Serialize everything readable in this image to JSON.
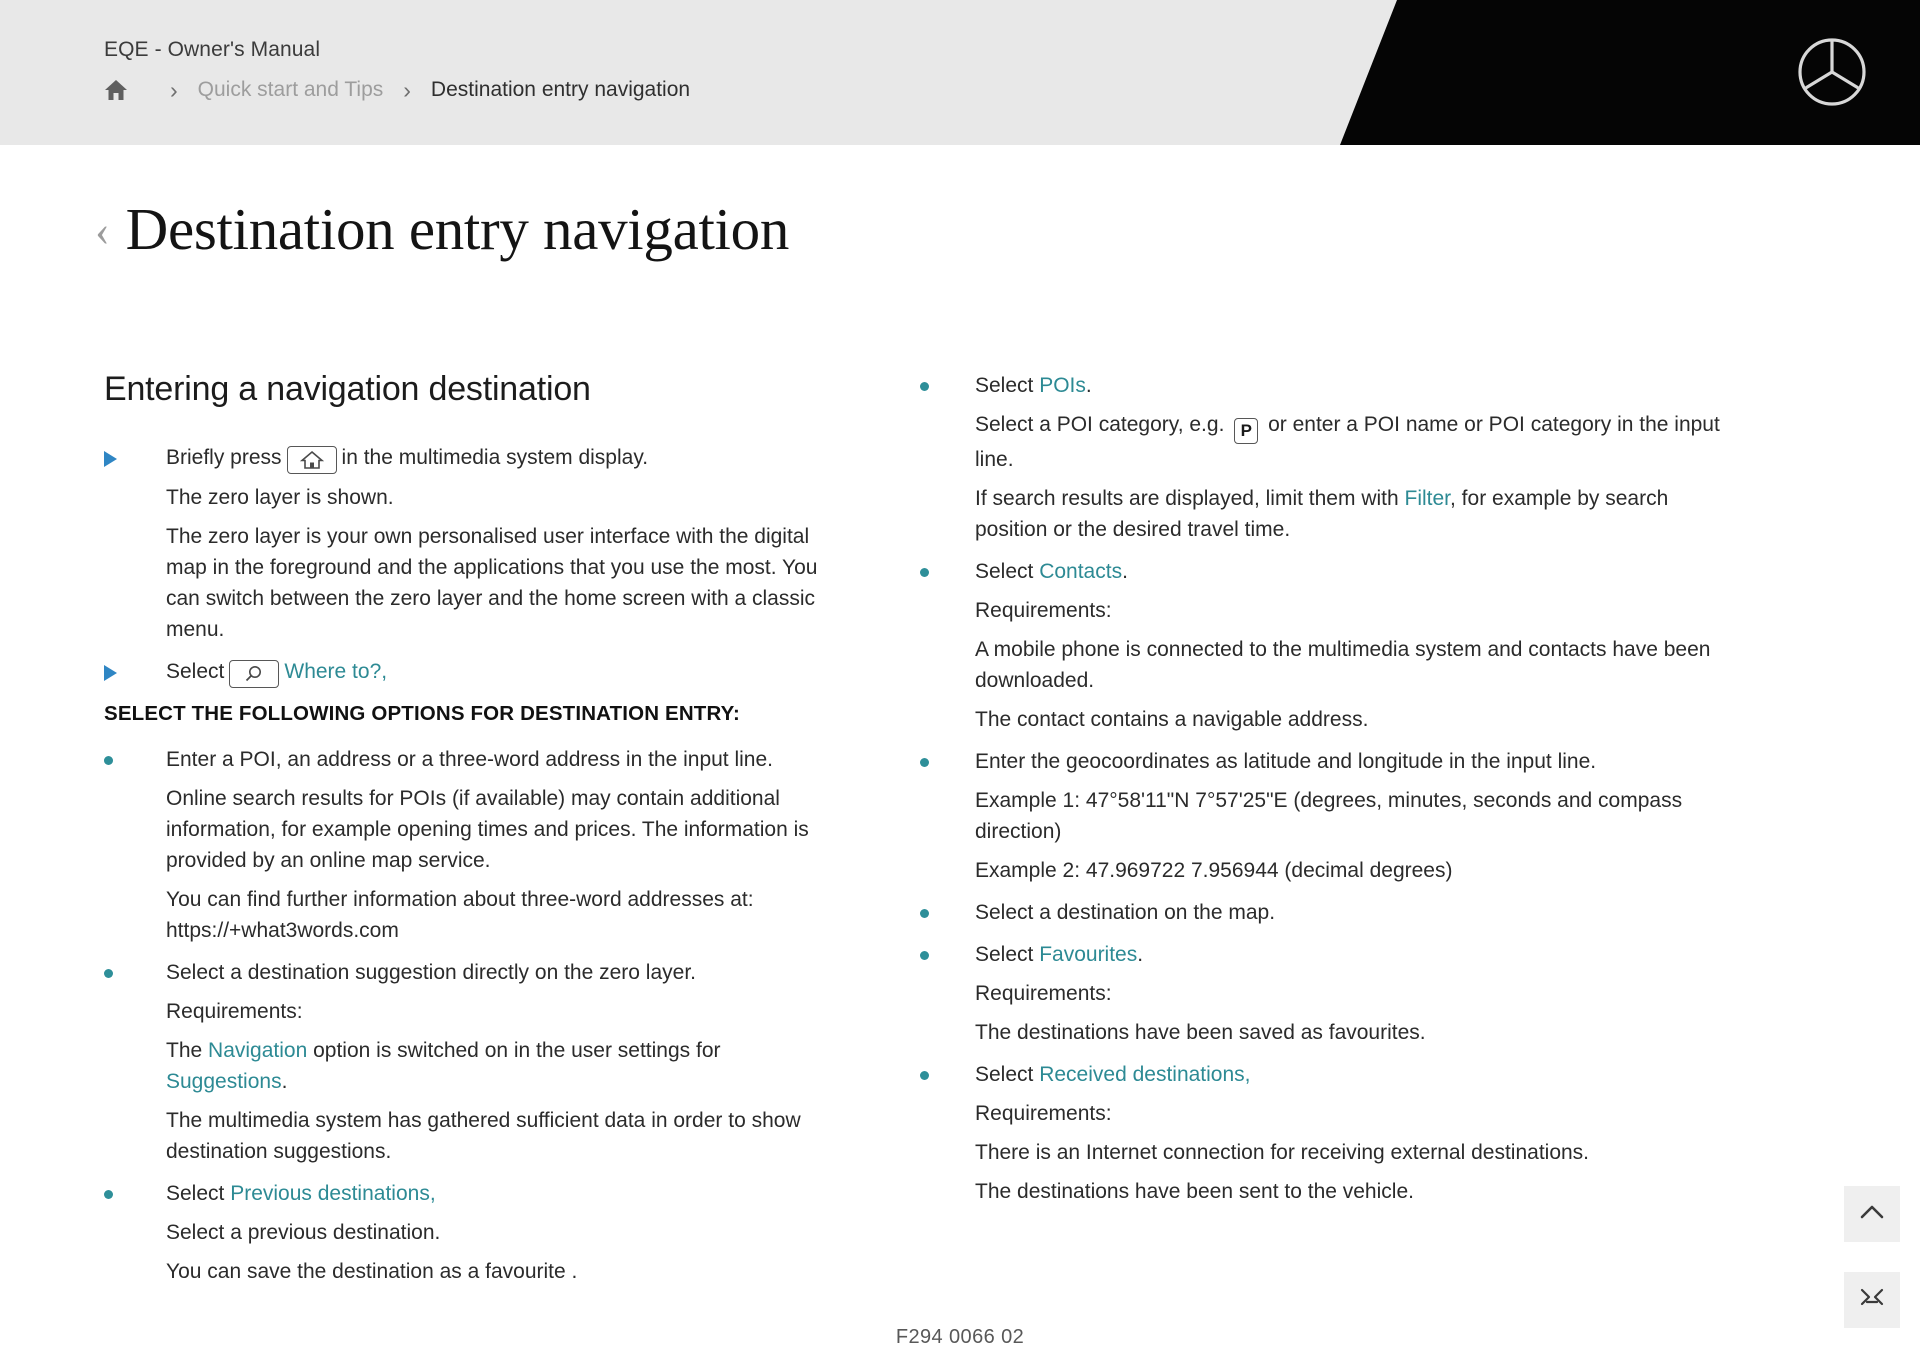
{
  "header": {
    "brand_title": "EQE - Owner's Manual",
    "breadcrumb": {
      "home_icon": "home-icon",
      "separator": "›",
      "parent": "Quick start and Tips",
      "current": "Destination entry navigation"
    },
    "logo_icon": "mercedes-benz-star-icon",
    "colors": {
      "bar": "#e8e8e8",
      "accent_black": "#050505"
    }
  },
  "title": {
    "back_icon": "‹",
    "text": "Destination entry navigation"
  },
  "left_column": {
    "section_heading": "Entering a navigation destination",
    "step_1": {
      "marker": "triangle",
      "text_before": "Briefly press",
      "icon": "home-screen-icon",
      "text_after": "in the multimedia system display.",
      "sub_lines": [
        "The zero layer is shown.",
        "The zero layer is your own personalised user interface with the digital map in the foreground and the applications that you use the most. You can switch between the zero layer and the home screen with a classic menu."
      ]
    },
    "step_2": {
      "marker": "triangle",
      "text_before": "Select",
      "icon": "magnifier-search-icon",
      "link": "Where to?",
      "text_after": ","
    },
    "options_heading": "SELECT THE FOLLOWING OPTIONS FOR DESTINATION ENTRY:",
    "bullets": [
      {
        "lead": "Enter a POI, an address or a three-word address in the input line.",
        "paras": [
          "Online search results for POIs (if available) may contain additional information, for example opening times and prices. The information is provided by an online map service.",
          "You can find further information about three-word addresses at: https://+what3words.com"
        ]
      },
      {
        "lead": "Select a destination suggestion directly on the zero layer.",
        "paras": [
          "Requirements:"
        ],
        "rich_line": {
          "p1": "The ",
          "link1": "Navigation",
          "p2": " option is switched on in the user settings for ",
          "link2": "Suggestions",
          "p3": "."
        },
        "tail": "The multimedia system has gathered sufficient data in order to show destination suggestions."
      },
      {
        "lead_prefix": "Select ",
        "lead_link": "Previous destinations",
        "lead_suffix": ",",
        "paras": [
          "Select a previous destination.",
          "You can save the destination as a favourite ."
        ]
      }
    ]
  },
  "right_column": {
    "bullets": [
      {
        "lead_prefix": "Select ",
        "lead_link": "POIs",
        "lead_suffix": ".",
        "icon_line": {
          "p1": "Select a POI category, e.g. ",
          "icon": "parking-p-icon",
          "p2": " or enter a POI name or POI category in the input line."
        },
        "filter_line": {
          "p1": "If search results are displayed, limit them with ",
          "link": "Filter",
          "p2": ", for example by search position or the desired travel time."
        }
      },
      {
        "lead_prefix": "Select ",
        "lead_link": "Contacts",
        "lead_suffix": ".",
        "paras": [
          "Requirements:",
          "A mobile phone is connected to the multimedia system and contacts have been downloaded.",
          "The contact contains a navigable address."
        ]
      },
      {
        "lead": "Enter the geocoordinates as latitude and longitude in the input line.",
        "paras": [
          "Example 1: 47°58'11\"N 7°57'25\"E (degrees, minutes, seconds and compass direction)",
          "Example 2: 47.969722 7.956944 (decimal degrees)"
        ]
      },
      {
        "lead": "Select a destination on the map."
      },
      {
        "lead_prefix": "Select ",
        "lead_link": "Favourites",
        "lead_suffix": ".",
        "paras": [
          "Requirements:",
          "The destinations have been saved as favourites."
        ]
      },
      {
        "lead_prefix": "Select ",
        "lead_link": "Received destinations",
        "lead_suffix": ",",
        "paras": [
          "Requirements:",
          "There is an Internet connection for receiving external destinations.",
          "The destinations have been sent to the vehicle."
        ]
      }
    ]
  },
  "floating_buttons": {
    "scroll_top_icon": "chevron-up-icon",
    "expand_icon": "expand-fullscreen-icon"
  },
  "footer": {
    "document_code": "F294 0066 02"
  },
  "colors": {
    "link_teal": "#2d8a94",
    "bullet_teal": "#2e8f99",
    "triangle_blue": "#2f86c4",
    "body_text": "#2b2b2b"
  }
}
